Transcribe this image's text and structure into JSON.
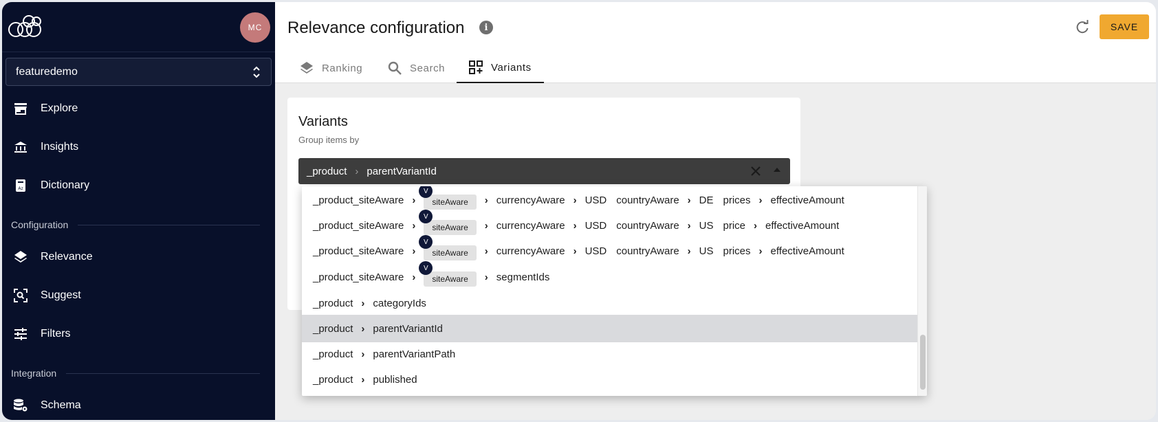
{
  "sidebar": {
    "avatar_initials": "MC",
    "project": "featuredemo",
    "items": [
      {
        "label": "Explore",
        "icon": "storefront-icon"
      },
      {
        "label": "Insights",
        "icon": "bank-icon"
      },
      {
        "label": "Dictionary",
        "icon": "book-icon"
      },
      {
        "label": "Relevance",
        "icon": "layers-icon"
      },
      {
        "label": "Suggest",
        "icon": "search-focus-icon"
      },
      {
        "label": "Filters",
        "icon": "tune-icon"
      },
      {
        "label": "Schema",
        "icon": "database-gear-icon"
      }
    ],
    "sections": {
      "configuration": "Configuration",
      "integration": "Integration"
    }
  },
  "header": {
    "title": "Relevance configuration",
    "info_glyph": "i",
    "save_label": "SAVE",
    "tabs": [
      {
        "label": "Ranking",
        "icon": "layers-icon"
      },
      {
        "label": "Search",
        "icon": "search-icon"
      },
      {
        "label": "Variants",
        "icon": "grid-plus-icon",
        "active": true
      }
    ]
  },
  "card": {
    "title": "Variants",
    "subtitle": "Group items by",
    "selected_path": [
      "_product",
      "parentVariantId"
    ]
  },
  "dropdown": {
    "chip_label": "siteAware",
    "chip_badge": "V",
    "options": [
      {
        "p1": "_product_siteAware",
        "rest": [
          "currencyAware",
          "USD",
          "countryAware",
          "DE",
          "prices",
          "effectiveAmount"
        ]
      },
      {
        "p1": "_product_siteAware",
        "rest": [
          "currencyAware",
          "USD",
          "countryAware",
          "US",
          "price",
          "effectiveAmount"
        ]
      },
      {
        "p1": "_product_siteAware",
        "rest": [
          "currencyAware",
          "USD",
          "countryAware",
          "US",
          "prices",
          "effectiveAmount"
        ]
      },
      {
        "p1": "_product_siteAware",
        "rest": [
          "segmentIds"
        ]
      },
      {
        "p1": "_product",
        "rest": [
          "categoryIds"
        ]
      },
      {
        "p1": "_product",
        "rest": [
          "parentVariantId"
        ],
        "selected": true
      },
      {
        "p1": "_product",
        "rest": [
          "parentVariantPath"
        ]
      },
      {
        "p1": "_product",
        "rest": [
          "published"
        ]
      }
    ]
  },
  "colors": {
    "sidebar_bg": "#08102a",
    "accent": "#f0a830",
    "avatar": "#c47a7a"
  }
}
